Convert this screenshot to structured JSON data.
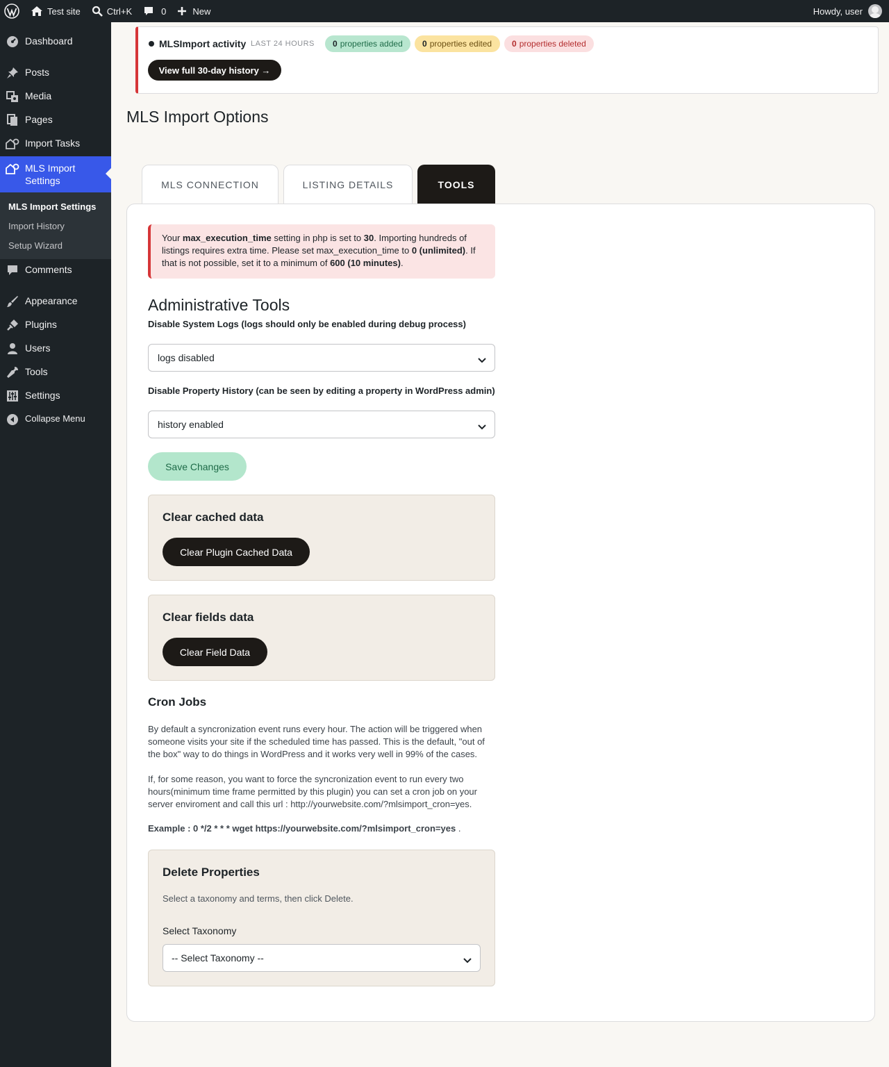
{
  "adminbar": {
    "site_name": "Test site",
    "search_shortcut": "Ctrl+K",
    "comments_count": "0",
    "new_label": "New",
    "howdy": "Howdy, user"
  },
  "sidebar": {
    "items": [
      {
        "label": "Dashboard"
      },
      {
        "label": "Posts"
      },
      {
        "label": "Media"
      },
      {
        "label": "Pages"
      },
      {
        "label": "Import Tasks"
      },
      {
        "label": "MLS Import Settings"
      },
      {
        "label": "Comments"
      },
      {
        "label": "Appearance"
      },
      {
        "label": "Plugins"
      },
      {
        "label": "Users"
      },
      {
        "label": "Tools"
      },
      {
        "label": "Settings"
      },
      {
        "label": "Collapse Menu"
      }
    ],
    "submenu": [
      {
        "label": "MLS Import Settings"
      },
      {
        "label": "Import History"
      },
      {
        "label": "Setup Wizard"
      }
    ]
  },
  "activity": {
    "title": "MLSImport activity",
    "subtitle": "LAST 24 HOURS",
    "added_count": "0",
    "added_label": "properties added",
    "edited_count": "0",
    "edited_label": "properties edited",
    "deleted_count": "0",
    "deleted_label": "properties deleted",
    "history_button": "View full 30-day history →"
  },
  "page_title": "MLS Import Options",
  "tabs": [
    {
      "label": "MLS CONNECTION"
    },
    {
      "label": "LISTING DETAILS"
    },
    {
      "label": "TOOLS"
    }
  ],
  "notice": {
    "p1": "Your ",
    "b1": "max_execution_time",
    "p2": " setting in php is set to ",
    "b2": "30",
    "p3": ". Importing hundreds of listings requires extra time. Please set max_execution_time to ",
    "b3": "0 (unlimited)",
    "p4": ". If that is not possible, set it to a minimum of ",
    "b4": "600 (10 minutes)",
    "p5": "."
  },
  "admin_tools": {
    "heading": "Administrative Tools",
    "logs_label": "Disable System Logs (logs should only be enabled during debug process)",
    "logs_value": "logs disabled",
    "history_label": "Disable Property History (can be seen by editing a property in WordPress admin)",
    "history_value": "history enabled",
    "save_button": "Save Changes"
  },
  "cache_box": {
    "title": "Clear cached data",
    "button": "Clear Plugin Cached Data"
  },
  "fields_box": {
    "title": "Clear fields data",
    "button": "Clear Field Data"
  },
  "cron": {
    "title": "Cron Jobs",
    "para1": "By default a syncronization event runs every hour. The action will be triggered when someone visits your site if the scheduled time has passed. This is the default, \"out of the box\" way to do things in WordPress and it works very well in 99% of the cases.",
    "para2": "If, for some reason, you want to force the syncronization event to run every two hours(minimum time frame permitted by this plugin) you can set a cron job on your server enviroment and call this url : http://yourwebsite.com/?mlsimport_cron=yes.",
    "example": "Example : 0 */2 * * * wget https://yourwebsite.com/?mlsimport_cron=yes",
    "example_end": " ."
  },
  "delete_box": {
    "title": "Delete Properties",
    "description": "Select a taxonomy and terms, then click Delete.",
    "taxonomy_label": "Select Taxonomy",
    "taxonomy_value": "-- Select Taxonomy --"
  },
  "colors": {
    "accent": "#3858e9",
    "dark": "#1d1a17",
    "notice_border": "#d63638"
  }
}
